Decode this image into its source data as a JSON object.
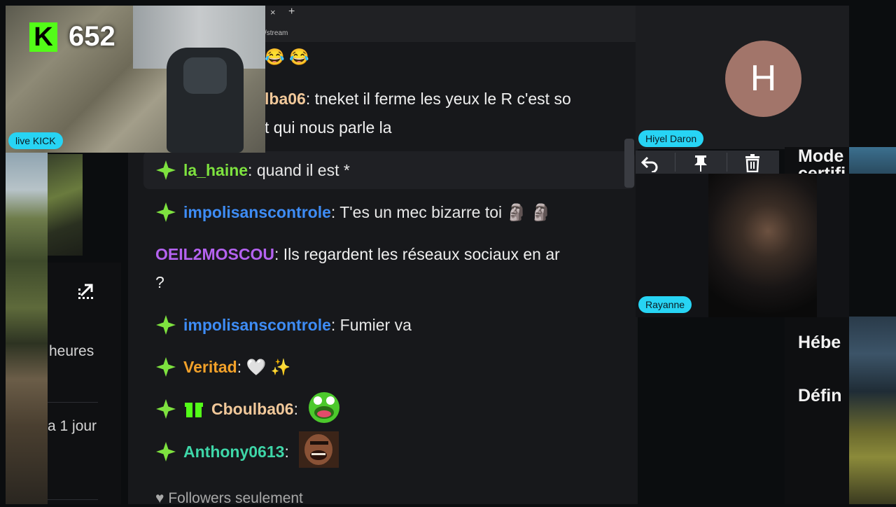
{
  "browser": {
    "tab_close": "×",
    "tab_new": "+",
    "url_fragment": "/stream"
  },
  "stream_overlay": {
    "viewer_count": "652",
    "kick_logo_letter": "K",
    "live_label": "live KICK"
  },
  "left_panel": {
    "expand_icon": "expand-icon",
    "text_hours": "heures",
    "text_day": "a 1 jour"
  },
  "chat": {
    "messages": [
      {
        "user": "",
        "text": "😂 😂",
        "user_color": "#f1c27a"
      },
      {
        "user": "lba06",
        "text": ": tneket il ferme les yeux le R c'est so",
        "continuation": "t qui nous parle la",
        "user_color": "#f1c89a"
      },
      {
        "user": "la_haine",
        "text": ": quand il est *",
        "user_color": "#7ee23f",
        "badge": "sparkle-badge-icon"
      },
      {
        "user": "impolisanscontrole",
        "text": ": T'es un mec bizarre toi 🗿 🗿",
        "user_color": "#3e8cf5",
        "badge": "sparkle-badge-icon"
      },
      {
        "user": "OEIL2MOSCOU",
        "text": ": Ils regardent les réseaux sociaux en ar",
        "continuation": "?",
        "user_color": "#b462f0"
      },
      {
        "user": "impolisanscontrole",
        "text": ": Fumier va",
        "user_color": "#3e8cf5",
        "badge": "sparkle-badge-icon"
      },
      {
        "user": "Veritad",
        "text": ": 🤍 ✨",
        "user_color": "#f2a12a",
        "badge": "sparkle-badge-icon"
      },
      {
        "user": "Cboulba06",
        "text": ":",
        "user_color": "#f1c89a",
        "badge": "sparkle-badge-icon",
        "badge2": "gift-badge-icon",
        "emote": "laughing-frog-emote"
      },
      {
        "user": "Anthony0613",
        "text": ":",
        "user_color": "#3ed6a8",
        "badge": "sparkle-badge-icon",
        "emote": "laughing-man-emote"
      }
    ],
    "footer": "Followers seulement"
  },
  "participants": {
    "host_initial": "H",
    "host_name": "Hiyel Daron",
    "guest_name": "Rayanne"
  },
  "mod_toolbar": {
    "reply_icon": "reply-icon",
    "pin_icon": "pin-icon",
    "delete_icon": "trash-icon"
  },
  "right_panel": {
    "line1": "Mode",
    "line1b": "certifi",
    "line2": "Hébe",
    "line3": "Défin"
  },
  "colors": {
    "kick_green": "#53fc18",
    "pill_blue": "#27d4f4",
    "badge_green": "#7ee23f"
  }
}
